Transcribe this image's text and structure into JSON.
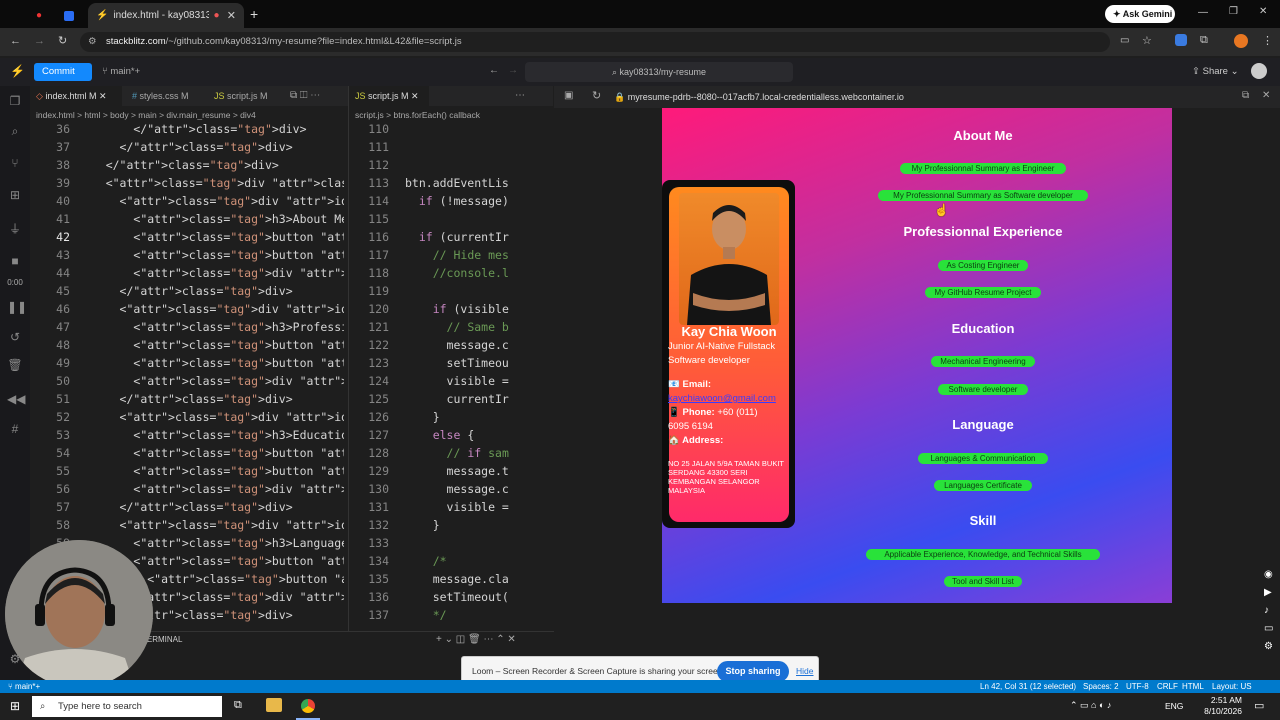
{
  "browser": {
    "tab_active_title": "index.html - kay08313/my-",
    "url_host": "stackblitz.com",
    "url_rest": "/~/github.com/kay08313/my-resume?file=index.html&L42&file=script.js",
    "ask_gemini": "Ask Gemini"
  },
  "stackblitz": {
    "commit_label": "Commit",
    "branch": "main*+",
    "search_text": "kay08313/my-resume",
    "share_label": "Share"
  },
  "editor1": {
    "tabs": [
      "index.html M",
      "styles.css M",
      "script.js M"
    ],
    "breadcrumb": "index.html  >  html  >  body  >  main  >  div.main_resume  >  div4",
    "lines": [
      {
        "n": "36",
        "t": "        </div>"
      },
      {
        "n": "37",
        "t": "      </div>"
      },
      {
        "n": "38",
        "t": "    </div>"
      },
      {
        "n": "39",
        "t": "    <div class=\"main_resume\">"
      },
      {
        "n": "40",
        "t": "      <div id=\"content1\">"
      },
      {
        "n": "41",
        "t": "        <h3>About Me</h3>"
      },
      {
        "n": "42",
        "t": "        <button class=\"myBtn\""
      },
      {
        "n": "43",
        "t": "        <button class=\"myBtn\""
      },
      {
        "n": "44",
        "t": "        <div class=\"message\""
      },
      {
        "n": "45",
        "t": "      </div>"
      },
      {
        "n": "46",
        "t": "      <div id=\"content2\">"
      },
      {
        "n": "47",
        "t": "        <h3>Professionnal Exp"
      },
      {
        "n": "48",
        "t": "        <button class=\"myBtn\""
      },
      {
        "n": "49",
        "t": "        <button class=\"myBtn\""
      },
      {
        "n": "50",
        "t": "        <div class=\"message\""
      },
      {
        "n": "51",
        "t": "      </div>"
      },
      {
        "n": "52",
        "t": "      <div id=\"content3\">"
      },
      {
        "n": "53",
        "t": "        <h3>Education</h3>"
      },
      {
        "n": "54",
        "t": "        <button class=\"myBtn\""
      },
      {
        "n": "55",
        "t": "        <button class=\"myBtn\""
      },
      {
        "n": "56",
        "t": "        <div class=\"message\""
      },
      {
        "n": "57",
        "t": "      </div>"
      },
      {
        "n": "58",
        "t": "      <div id=\"content4\">"
      },
      {
        "n": "59",
        "t": "        <h3>Language</h3>"
      },
      {
        "n": "60",
        "t": "        <button class=\"myBtn\""
      },
      {
        "n": "61",
        "t": "          <button class=\"myBt"
      },
      {
        "n": "62",
        "t": "        <div class=\"message\""
      },
      {
        "n": "63",
        "t": "      </div>"
      }
    ]
  },
  "editor2": {
    "tabs": [
      "script.js M"
    ],
    "breadcrumb": "script.js  >  btns.forEach() callback",
    "lines": [
      {
        "n": "110",
        "t": ""
      },
      {
        "n": "111",
        "t": ""
      },
      {
        "n": "112",
        "t": ""
      },
      {
        "n": "113",
        "t": "btn.addEventLis"
      },
      {
        "n": "114",
        "t": "  if (!message)"
      },
      {
        "n": "115",
        "t": ""
      },
      {
        "n": "116",
        "t": "  if (currentIr"
      },
      {
        "n": "117",
        "t": "    // Hide mes"
      },
      {
        "n": "118",
        "t": "    //console.l"
      },
      {
        "n": "119",
        "t": ""
      },
      {
        "n": "120",
        "t": "    if (visible"
      },
      {
        "n": "121",
        "t": "      // Same b"
      },
      {
        "n": "122",
        "t": "      message.c"
      },
      {
        "n": "123",
        "t": "      setTimeou"
      },
      {
        "n": "124",
        "t": "      visible ="
      },
      {
        "n": "125",
        "t": "      currentIr"
      },
      {
        "n": "126",
        "t": "    }"
      },
      {
        "n": "127",
        "t": "    else {"
      },
      {
        "n": "128",
        "t": "      // if sam"
      },
      {
        "n": "129",
        "t": "      message.t"
      },
      {
        "n": "130",
        "t": "      message.c"
      },
      {
        "n": "131",
        "t": "      visible ="
      },
      {
        "n": "132",
        "t": "    }"
      },
      {
        "n": "133",
        "t": ""
      },
      {
        "n": "134",
        "t": "    /*"
      },
      {
        "n": "135",
        "t": "    message.cla"
      },
      {
        "n": "136",
        "t": "    setTimeout("
      },
      {
        "n": "137",
        "t": "    */"
      }
    ]
  },
  "preview": {
    "url": "myresume-pdrb--8080--017acfb7.local-credentialless.webcontainer.io",
    "profile": {
      "name": "Kay Chia Woon",
      "role1": "Junior AI-Native Fullstack",
      "role2": "Software developer",
      "email_label": "Email:",
      "email": "kaychiawoon@gmail.com",
      "phone_label": "Phone:",
      "phone1": "+60 (011)",
      "phone2": "6095 6194",
      "address_label": "Address:",
      "address": "NO 25 JALAN 5/9A TAMAN BUKIT SERDANG 43300 SERI KEMBANGAN SELANGOR MALAYSIA"
    },
    "sections": [
      {
        "title": "About Me",
        "buttons": [
          "My Professionnal Summary as Engineer",
          "My Professionnal Summary as Software developer"
        ]
      },
      {
        "title": "Professionnal Experience",
        "buttons": [
          "As Costing Engineer",
          "My GitHub Resume Project"
        ]
      },
      {
        "title": "Education",
        "buttons": [
          "Mechanical Engineering",
          "Software developer"
        ]
      },
      {
        "title": "Language",
        "buttons": [
          "Languages & Communication",
          "Languages Certificate"
        ]
      },
      {
        "title": "Skill",
        "buttons": [
          "Applicable Experience, Knowledge, and Technical Skills",
          "Tool and Skill List"
        ]
      }
    ]
  },
  "panel": {
    "terminal_label": "TERMINAL"
  },
  "loom": {
    "message": "Loom – Screen Recorder & Screen Capture is sharing your screen.",
    "stop_label": "Stop sharing",
    "hide_label": "Hide"
  },
  "statusbar": {
    "branch": "main*+",
    "position": "Ln 42, Col 31 (12 selected)",
    "spaces": "Spaces: 2",
    "encoding": "UTF-8",
    "eol": "CRLF",
    "language": "HTML",
    "layout": "Layout: US"
  },
  "recorder": {
    "time": "0:00"
  },
  "taskbar": {
    "search_placeholder": "Type here to search",
    "lang": "ENG",
    "time": "2:51 AM",
    "date": "8/10/2026"
  }
}
